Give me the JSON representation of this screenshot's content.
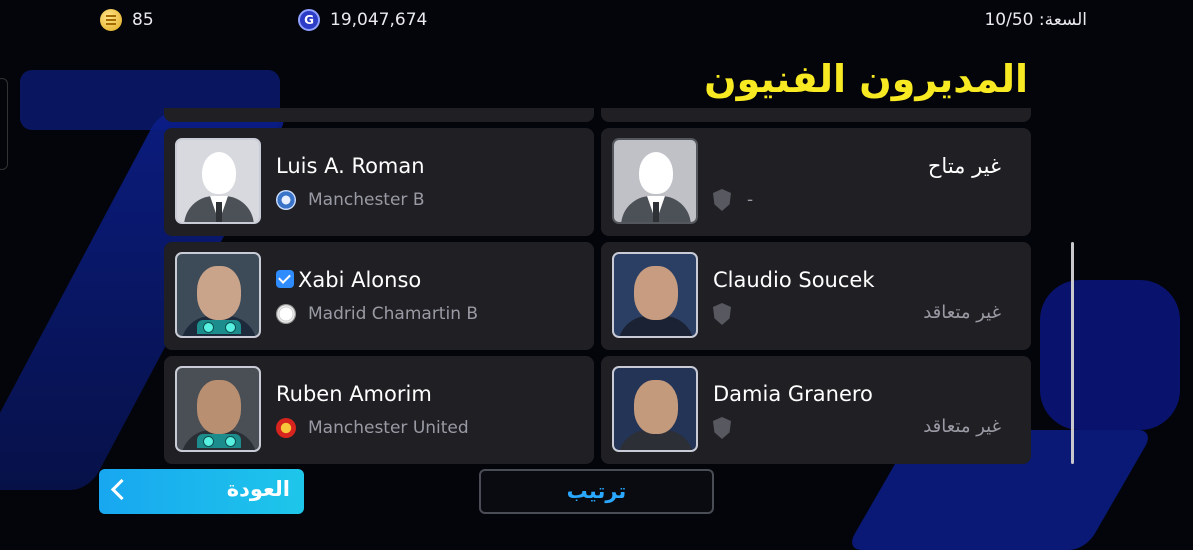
{
  "status_bar": {
    "coins_icon": "efootball-coin-icon",
    "coins": "85",
    "gp_icon": "gp-icon",
    "gp_icon_letter": "G",
    "gp": "19,047,674",
    "capacity": "السعة: 10/50"
  },
  "title": "المديرون الفنيون",
  "managers": [
    {
      "name": "Luis A. Roman",
      "club": "Manchester B",
      "photo": "silhouette",
      "verified": false,
      "skill_badges": false
    },
    {
      "name": "غير متاح",
      "club": "-",
      "photo": "silhouette",
      "club_icon": "shield-icon"
    },
    {
      "name": "Xabi Alonso",
      "club": "Madrid Chamartin B",
      "photo": "manager-photo",
      "verified": true,
      "skill_badges": true
    },
    {
      "name": "Claudio Soucek",
      "status": "غير متعاقد",
      "photo": "manager-photo",
      "club_icon": "shield-icon"
    },
    {
      "name": "Ruben Amorim",
      "club": "Manchester United",
      "photo": "manager-photo",
      "verified": false,
      "skill_badges": true
    },
    {
      "name": "Damia Granero",
      "status": "غير متعاقد",
      "photo": "manager-photo",
      "club_icon": "shield-icon"
    }
  ],
  "buttons": {
    "back": "العودة",
    "sort": "ترتيب"
  },
  "colors": {
    "title": "#f7ea22",
    "back_button": "#18a7f0",
    "sort_text": "#2aa8ff",
    "card": "#1f1f24",
    "verified": "#2f8cff"
  }
}
